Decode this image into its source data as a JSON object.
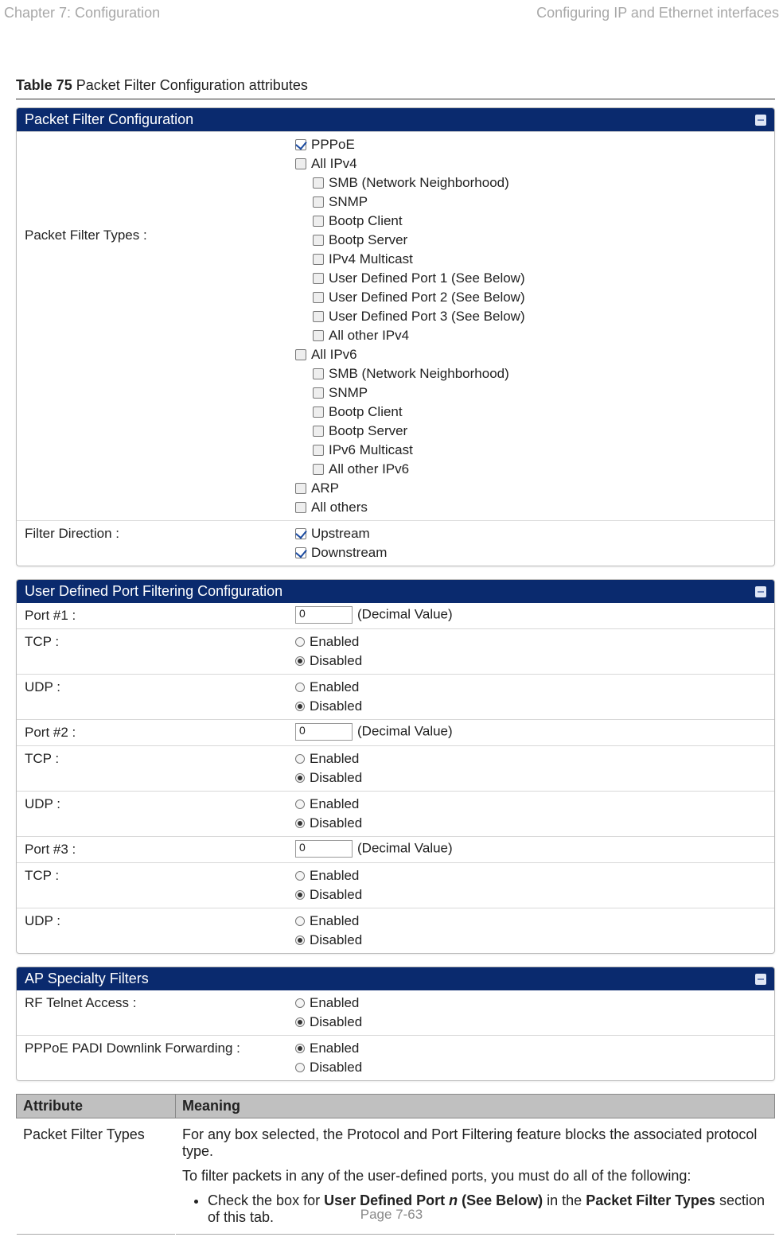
{
  "header": {
    "left": "Chapter 7:  Configuration",
    "right": "Configuring IP and Ethernet interfaces"
  },
  "caption": {
    "bold": "Table 75",
    "rest": " Packet Filter Configuration attributes"
  },
  "panels": {
    "p1": {
      "title": "Packet Filter Configuration",
      "row1label": "Packet Filter Types :",
      "row2label": "Filter Direction :",
      "types": [
        {
          "lbl": "PPPoE",
          "indent": 0,
          "checked": true
        },
        {
          "lbl": "All IPv4",
          "indent": 0,
          "checked": false
        },
        {
          "lbl": "SMB (Network Neighborhood)",
          "indent": 1,
          "checked": false
        },
        {
          "lbl": "SNMP",
          "indent": 1,
          "checked": false
        },
        {
          "lbl": "Bootp Client",
          "indent": 1,
          "checked": false
        },
        {
          "lbl": "Bootp Server",
          "indent": 1,
          "checked": false
        },
        {
          "lbl": "IPv4 Multicast",
          "indent": 1,
          "checked": false
        },
        {
          "lbl": "User Defined Port 1 (See Below)",
          "indent": 1,
          "checked": false
        },
        {
          "lbl": "User Defined Port 2 (See Below)",
          "indent": 1,
          "checked": false
        },
        {
          "lbl": "User Defined Port 3 (See Below)",
          "indent": 1,
          "checked": false
        },
        {
          "lbl": "All other IPv4",
          "indent": 1,
          "checked": false
        },
        {
          "lbl": "All IPv6",
          "indent": 0,
          "checked": false
        },
        {
          "lbl": "SMB (Network Neighborhood)",
          "indent": 1,
          "checked": false
        },
        {
          "lbl": "SNMP",
          "indent": 1,
          "checked": false
        },
        {
          "lbl": "Bootp Client",
          "indent": 1,
          "checked": false
        },
        {
          "lbl": "Bootp Server",
          "indent": 1,
          "checked": false
        },
        {
          "lbl": "IPv6 Multicast",
          "indent": 1,
          "checked": false
        },
        {
          "lbl": "All other IPv6",
          "indent": 1,
          "checked": false
        },
        {
          "lbl": "ARP",
          "indent": 0,
          "checked": false
        },
        {
          "lbl": "All others",
          "indent": 0,
          "checked": false
        }
      ],
      "direction": {
        "up_lbl": "Upstream",
        "up_checked": true,
        "down_lbl": "Downstream",
        "down_checked": true
      }
    },
    "p2": {
      "title": "User Defined Port Filtering Configuration",
      "hint": "(Decimal Value)",
      "enabled": "Enabled",
      "disabled": "Disabled",
      "rows": [
        {
          "label": "Port #1 :",
          "kind": "port",
          "value": "0"
        },
        {
          "label": "TCP :",
          "kind": "radio",
          "enabled": false
        },
        {
          "label": "UDP :",
          "kind": "radio",
          "enabled": false
        },
        {
          "label": "Port #2 :",
          "kind": "port",
          "value": "0"
        },
        {
          "label": "TCP :",
          "kind": "radio",
          "enabled": false
        },
        {
          "label": "UDP :",
          "kind": "radio",
          "enabled": false
        },
        {
          "label": "Port #3 :",
          "kind": "port",
          "value": "0"
        },
        {
          "label": "TCP :",
          "kind": "radio",
          "enabled": false
        },
        {
          "label": "UDP :",
          "kind": "radio",
          "enabled": false
        }
      ]
    },
    "p3": {
      "title": "AP Specialty Filters",
      "enabled": "Enabled",
      "disabled": "Disabled",
      "rows": [
        {
          "label": "RF Telnet Access :",
          "enabled": false
        },
        {
          "label": "PPPoE PADI Downlink Forwarding :",
          "enabled": true
        }
      ]
    }
  },
  "attrTable": {
    "h1": "Attribute",
    "h2": "Meaning",
    "row1": {
      "attr": "Packet Filter Types",
      "p1": "For any box selected, the Protocol and Port Filtering feature blocks the associated protocol type.",
      "p2": "To filter packets in any of the user-defined ports, you must do all of the following:",
      "b_pre": "Check the box for ",
      "b_bold1": "User Defined Port ",
      "b_italic": "n",
      "b_bold2": " (See Below)",
      "b_mid": " in the ",
      "b_bold3": "Packet Filter Types",
      "b_post": " section of this tab."
    }
  },
  "footer": "Page 7-63"
}
